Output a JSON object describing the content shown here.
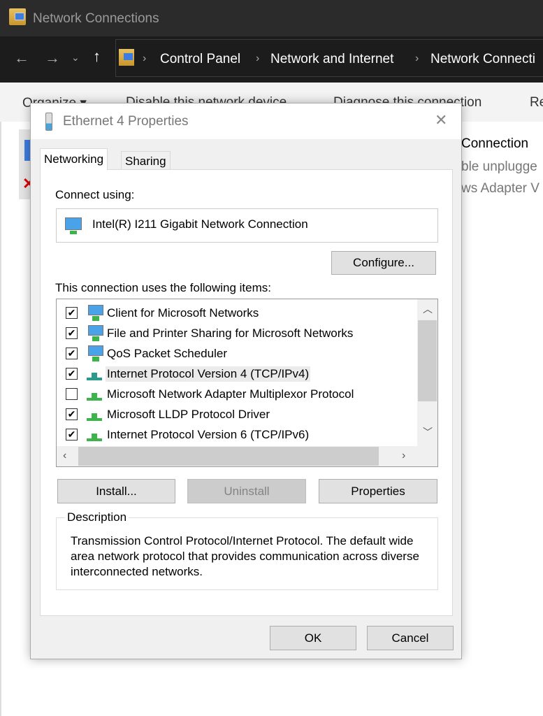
{
  "window": {
    "title": "Network Connections"
  },
  "nav": {
    "breadcrumb": [
      "Control Panel",
      "Network and Internet",
      "Network Connecti"
    ]
  },
  "toolbar": {
    "items": [
      "Organize ▾",
      "Disable this network device",
      "Diagnose this connection",
      "Re"
    ]
  },
  "background": {
    "connection_name": "Connection",
    "status": "ble unplugge",
    "adapter": "ws Adapter V"
  },
  "dialog": {
    "title": "Ethernet 4 Properties",
    "tabs": [
      {
        "label": "Networking",
        "active": true
      },
      {
        "label": "Sharing",
        "active": false
      }
    ],
    "connect_using_label": "Connect using:",
    "adapter_name": "Intel(R) I211 Gigabit Network Connection",
    "configure_button": "Configure...",
    "items_label": "This connection uses the following items:",
    "items": [
      {
        "label": "Client for Microsoft Networks",
        "checked": true,
        "icon": "network-client-icon"
      },
      {
        "label": "File and Printer Sharing for Microsoft Networks",
        "checked": true,
        "icon": "network-service-icon"
      },
      {
        "label": "QoS Packet Scheduler",
        "checked": true,
        "icon": "network-service-icon"
      },
      {
        "label": "Internet Protocol Version 4 (TCP/IPv4)",
        "checked": true,
        "icon": "protocol-icon",
        "selected": true
      },
      {
        "label": "Microsoft Network Adapter Multiplexor Protocol",
        "checked": false,
        "icon": "protocol-icon"
      },
      {
        "label": "Microsoft LLDP Protocol Driver",
        "checked": true,
        "icon": "protocol-icon"
      },
      {
        "label": "Internet Protocol Version 6 (TCP/IPv6)",
        "checked": true,
        "icon": "protocol-icon"
      }
    ],
    "install_button": "Install...",
    "uninstall_button": "Uninstall",
    "properties_button": "Properties",
    "description_label": "Description",
    "description_text": "Transmission Control Protocol/Internet Protocol. The default wide area network protocol that provides communication across diverse interconnected networks.",
    "ok_button": "OK",
    "cancel_button": "Cancel"
  }
}
